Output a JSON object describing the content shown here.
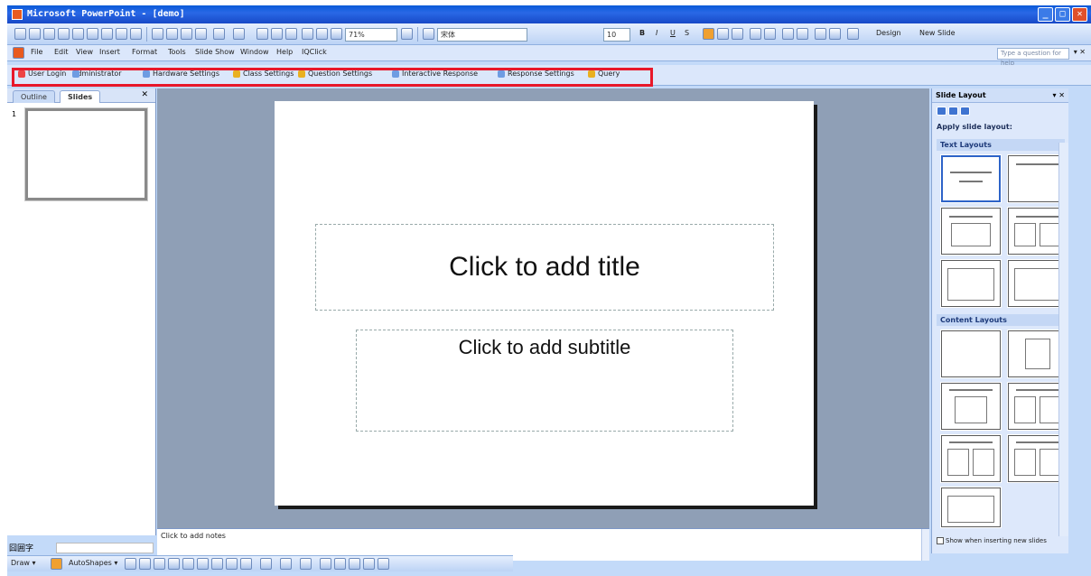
{
  "window": {
    "title": "Microsoft PowerPoint - [demo]",
    "controls": [
      "_",
      "□",
      "✕"
    ]
  },
  "standard_toolbar": {
    "zoom": "71%",
    "font_name": "宋体",
    "font_size": "10",
    "bold": "B",
    "italic": "I",
    "underline": "U",
    "shadow": "S",
    "design_label": "Design",
    "new_slide_label": "New Slide"
  },
  "menu": {
    "items": [
      "File",
      "Edit",
      "View",
      "Insert",
      "Format",
      "Tools",
      "Slide Show",
      "Window",
      "Help",
      "IQClick"
    ],
    "help_placeholder": "Type a question for help"
  },
  "custom_toolbar": {
    "items": [
      "User Login",
      "Administrator",
      "Hardware Settings",
      "Class Settings",
      "Question Settings",
      "Interactive Response",
      "Response Settings",
      "Query"
    ]
  },
  "slides_pane": {
    "tabs": [
      "Outline",
      "Slides"
    ],
    "close": "✕",
    "thumb_number": "1"
  },
  "slide": {
    "title_placeholder": "Click to add title",
    "subtitle_placeholder": "Click to add subtitle"
  },
  "notes": {
    "placeholder": "Click to add notes"
  },
  "task_pane": {
    "title": "Slide Layout",
    "close": "▾ ✕",
    "apply_label": "Apply slide layout:",
    "sections": [
      "Text Layouts",
      "Content Layouts"
    ],
    "checkbox_label": "Show when inserting new slides"
  },
  "ime_bar": {
    "text": "囧囲字"
  },
  "drawing_toolbar": {
    "draw_label": "Draw ▾",
    "autoshapes_label": "AutoShapes ▾"
  }
}
